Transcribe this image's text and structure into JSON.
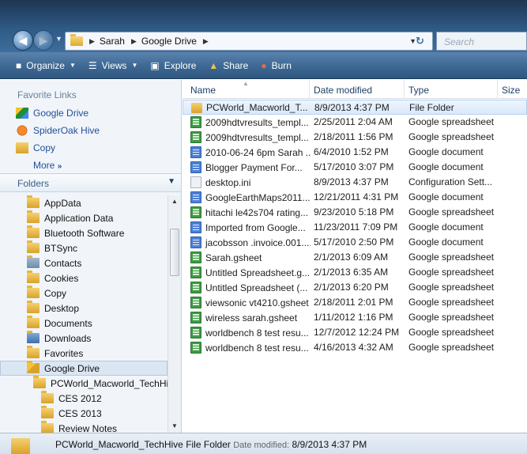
{
  "address_bar": {
    "breadcrumbs": [
      "Sarah",
      "Google Drive"
    ],
    "search_placeholder": "Search"
  },
  "toolbar": {
    "items": [
      {
        "label": "Organize",
        "icon": "organize-icon",
        "dropdown": true
      },
      {
        "label": "Views",
        "icon": "views-icon",
        "dropdown": true
      },
      {
        "label": "Explore",
        "icon": "explore-icon",
        "dropdown": false
      },
      {
        "label": "Share",
        "icon": "share-icon",
        "dropdown": false
      },
      {
        "label": "Burn",
        "icon": "burn-icon",
        "dropdown": false
      }
    ]
  },
  "sidebar": {
    "favorites_header": "Favorite Links",
    "favorites": [
      {
        "label": "Google Drive",
        "icon": "google-drive-icon"
      },
      {
        "label": "SpiderOak Hive",
        "icon": "spideroak-icon"
      },
      {
        "label": "Copy",
        "icon": "copy-icon"
      }
    ],
    "more_label": "More",
    "folders_header": "Folders",
    "tree": [
      {
        "label": "AppData",
        "indent": 1,
        "icon": "folder-icon"
      },
      {
        "label": "Application Data",
        "indent": 1,
        "icon": "shortcut-folder-icon"
      },
      {
        "label": "Bluetooth Software",
        "indent": 1,
        "icon": "folder-icon"
      },
      {
        "label": "BTSync",
        "indent": 1,
        "icon": "folder-icon"
      },
      {
        "label": "Contacts",
        "indent": 1,
        "icon": "contacts-icon"
      },
      {
        "label": "Cookies",
        "indent": 1,
        "icon": "shortcut-folder-icon"
      },
      {
        "label": "Copy",
        "indent": 1,
        "icon": "copy-icon"
      },
      {
        "label": "Desktop",
        "indent": 1,
        "icon": "folder-icon"
      },
      {
        "label": "Documents",
        "indent": 1,
        "icon": "folder-icon"
      },
      {
        "label": "Downloads",
        "indent": 1,
        "icon": "downloads-icon"
      },
      {
        "label": "Favorites",
        "indent": 1,
        "icon": "favorites-icon"
      },
      {
        "label": "Google Drive",
        "indent": 1,
        "icon": "google-drive-icon",
        "selected": true
      },
      {
        "label": "PCWorld_Macworld_TechHi",
        "indent": 2,
        "icon": "folder-icon"
      },
      {
        "label": "CES 2012",
        "indent": 3,
        "icon": "folder-icon"
      },
      {
        "label": "CES 2013",
        "indent": 3,
        "icon": "folder-icon"
      },
      {
        "label": "Review Notes",
        "indent": 3,
        "icon": "folder-icon"
      }
    ]
  },
  "file_list": {
    "columns": [
      "Name",
      "Date modified",
      "Type",
      "Size"
    ],
    "rows": [
      {
        "name": "PCWorld_Macworld_T...",
        "date": "8/9/2013 4:37 PM",
        "type": "File Folder",
        "icon": "folder",
        "selected": true
      },
      {
        "name": "2009hdtvresults_templ...",
        "date": "2/25/2011 2:04 AM",
        "type": "Google spreadsheet",
        "icon": "sheet"
      },
      {
        "name": "2009hdtvresults_templ...",
        "date": "2/18/2011 1:56 PM",
        "type": "Google spreadsheet",
        "icon": "sheet"
      },
      {
        "name": "2010-06-24 6pm Sarah ...",
        "date": "6/4/2010 1:52 PM",
        "type": "Google document",
        "icon": "doc"
      },
      {
        "name": "Blogger Payment For...",
        "date": "5/17/2010 3:07 PM",
        "type": "Google document",
        "icon": "doc"
      },
      {
        "name": "desktop.ini",
        "date": "8/9/2013 4:37 PM",
        "type": "Configuration Sett...",
        "icon": "ini"
      },
      {
        "name": "GoogleEarthMaps2011....",
        "date": "12/21/2011 4:31 PM",
        "type": "Google document",
        "icon": "doc"
      },
      {
        "name": "hitachi le42s704 rating...",
        "date": "9/23/2010 5:18 PM",
        "type": "Google spreadsheet",
        "icon": "sheet"
      },
      {
        "name": "Imported from Google...",
        "date": "11/23/2011 7:09 PM",
        "type": "Google document",
        "icon": "doc"
      },
      {
        "name": "jacobsson .invoice.001....",
        "date": "5/17/2010 2:50 PM",
        "type": "Google document",
        "icon": "doc"
      },
      {
        "name": "Sarah.gsheet",
        "date": "2/1/2013 6:09 AM",
        "type": "Google spreadsheet",
        "icon": "sheet"
      },
      {
        "name": "Untitled Spreadsheet.g...",
        "date": "2/1/2013 6:35 AM",
        "type": "Google spreadsheet",
        "icon": "sheet"
      },
      {
        "name": "Untitled Spreadsheet (...",
        "date": "2/1/2013 6:20 PM",
        "type": "Google spreadsheet",
        "icon": "sheet"
      },
      {
        "name": "viewsonic vt4210.gsheet",
        "date": "2/18/2011 2:01 PM",
        "type": "Google spreadsheet",
        "icon": "sheet"
      },
      {
        "name": "wireless sarah.gsheet",
        "date": "1/11/2012 1:16 PM",
        "type": "Google spreadsheet",
        "icon": "sheet"
      },
      {
        "name": "worldbench 8 test resu...",
        "date": "12/7/2012 12:24 PM",
        "type": "Google spreadsheet",
        "icon": "sheet"
      },
      {
        "name": "worldbench 8 test resu...",
        "date": "4/16/2013 4:32 AM",
        "type": "Google spreadsheet",
        "icon": "sheet"
      }
    ]
  },
  "status_bar": {
    "name": "PCWorld_Macworld_TechHive",
    "type": "File Folder",
    "date_label": "Date modified:",
    "date": "8/9/2013 4:37 PM"
  }
}
